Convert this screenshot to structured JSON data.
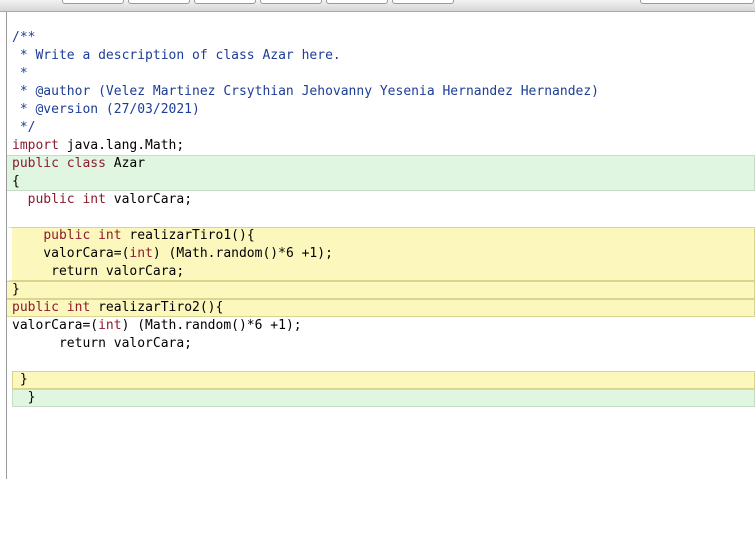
{
  "editor": {
    "lines": [
      {
        "parts": [
          {
            "t": "/**",
            "c": "comment"
          }
        ]
      },
      {
        "parts": [
          {
            "t": " * Write a description of class Azar here.",
            "c": "comment"
          }
        ]
      },
      {
        "parts": [
          {
            "t": " *",
            "c": "comment"
          }
        ]
      },
      {
        "parts": [
          {
            "t": " * @author (Velez Martinez Crsythian Jehovanny Yesenia Hernandez Hernandez)",
            "c": "comment"
          }
        ]
      },
      {
        "parts": [
          {
            "t": " * @version (27/03/2021)",
            "c": "comment"
          }
        ]
      },
      {
        "parts": [
          {
            "t": " */",
            "c": "comment"
          }
        ]
      },
      {
        "parts": [
          {
            "t": "import",
            "c": "kw"
          },
          {
            "t": " java.lang.Math;",
            "c": "punct"
          }
        ]
      },
      {
        "parts": [
          {
            "t": "public",
            "c": "kw"
          },
          {
            "t": " ",
            "c": "punct"
          },
          {
            "t": "class",
            "c": "kw"
          },
          {
            "t": " Azar",
            "c": "punct"
          }
        ]
      },
      {
        "parts": [
          {
            "t": "{",
            "c": "punct"
          }
        ]
      },
      {
        "parts": [
          {
            "t": "  ",
            "c": "punct"
          },
          {
            "t": "public",
            "c": "kw"
          },
          {
            "t": " ",
            "c": "punct"
          },
          {
            "t": "int",
            "c": "kw"
          },
          {
            "t": " valorCara;",
            "c": "punct"
          }
        ]
      },
      {
        "parts": [
          {
            "t": "",
            "c": "punct"
          }
        ]
      },
      {
        "parts": [
          {
            "t": "    ",
            "c": "punct"
          },
          {
            "t": "public",
            "c": "kw"
          },
          {
            "t": " ",
            "c": "punct"
          },
          {
            "t": "int",
            "c": "kw"
          },
          {
            "t": " realizarTiro1(){",
            "c": "punct"
          }
        ]
      },
      {
        "parts": [
          {
            "t": "    valorCara=(",
            "c": "punct"
          },
          {
            "t": "int",
            "c": "kw"
          },
          {
            "t": ") (Math.random()*6 +1);",
            "c": "punct"
          }
        ]
      },
      {
        "parts": [
          {
            "t": "     return valorCara;",
            "c": "punct"
          }
        ]
      },
      {
        "parts": [
          {
            "t": "}",
            "c": "punct"
          }
        ]
      },
      {
        "parts": [
          {
            "t": "public",
            "c": "kw"
          },
          {
            "t": " ",
            "c": "punct"
          },
          {
            "t": "int",
            "c": "kw"
          },
          {
            "t": " realizarTiro2(){",
            "c": "punct"
          }
        ]
      },
      {
        "parts": [
          {
            "t": "valorCara=(",
            "c": "punct"
          },
          {
            "t": "int",
            "c": "kw"
          },
          {
            "t": ") (Math.random()*6 +1);",
            "c": "punct"
          }
        ]
      },
      {
        "parts": [
          {
            "t": "      return valorCara;",
            "c": "punct"
          }
        ]
      },
      {
        "parts": [
          {
            "t": "",
            "c": "punct"
          }
        ]
      },
      {
        "parts": [
          {
            "t": " }",
            "c": "punct"
          }
        ]
      },
      {
        "parts": [
          {
            "t": "  }",
            "c": "punct"
          }
        ]
      }
    ]
  },
  "colors": {
    "comment": "#1d3d96",
    "keyword": "#8e1a2e",
    "class_scope": "#e0f6e0",
    "method_scope": "#fbf7bd"
  }
}
